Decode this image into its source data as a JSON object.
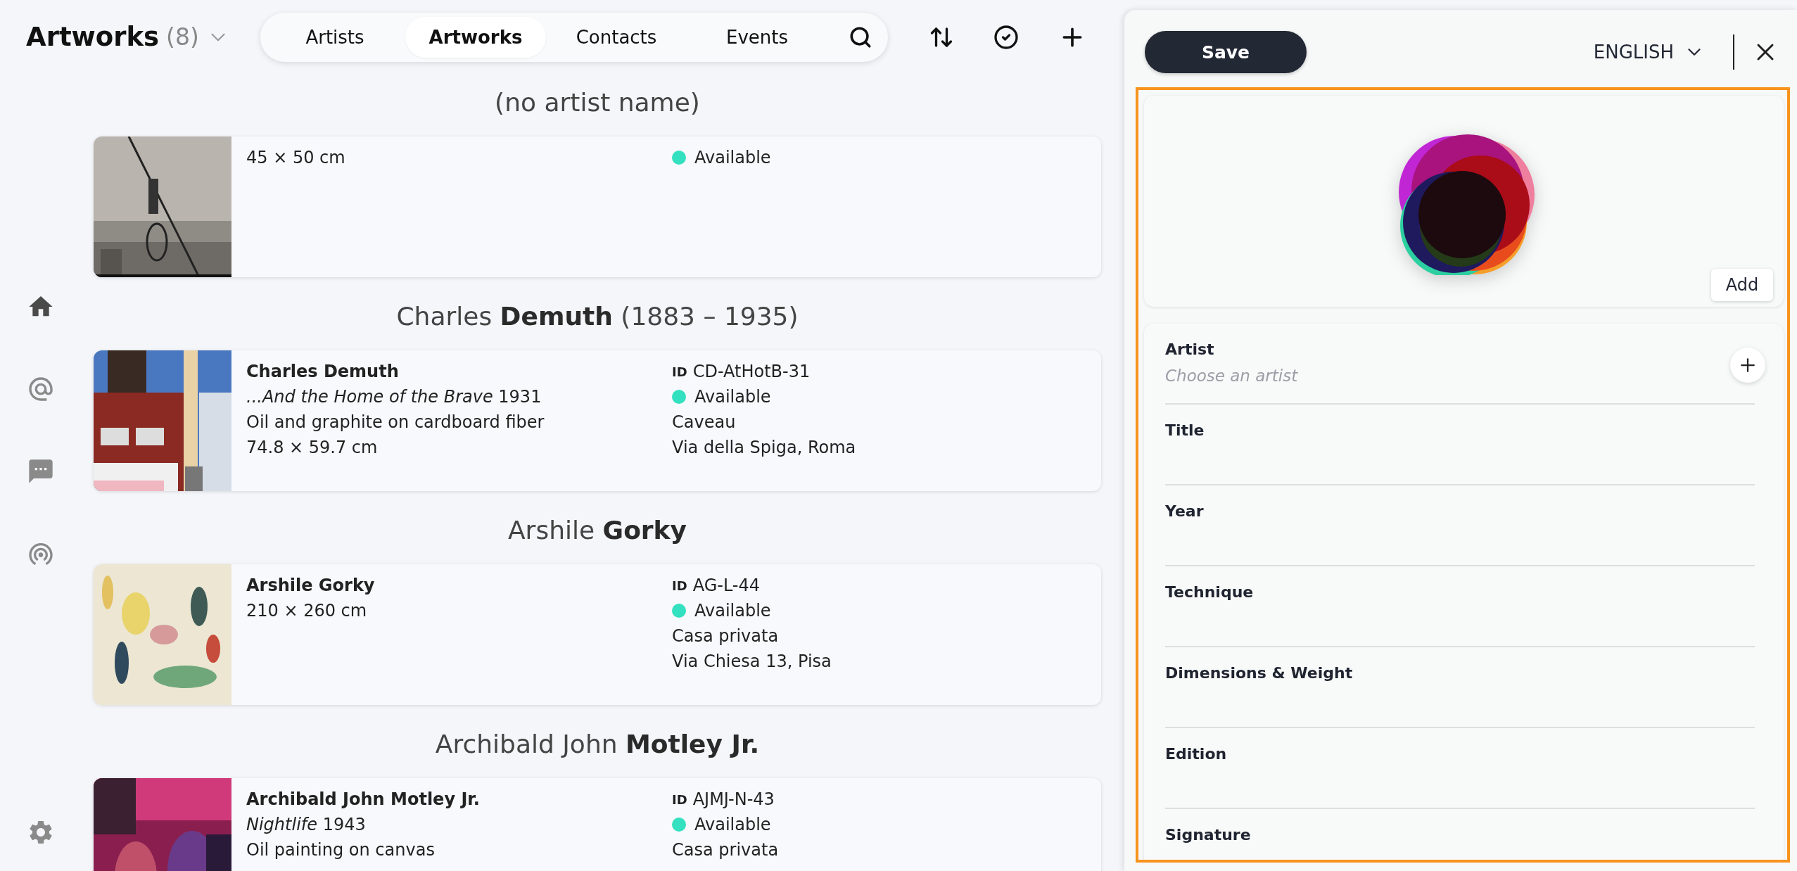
{
  "header": {
    "title": "Artworks",
    "count": "(8)"
  },
  "tabs": [
    {
      "label": "Artists",
      "selected": false
    },
    {
      "label": "Artworks",
      "selected": true
    },
    {
      "label": "Contacts",
      "selected": false
    },
    {
      "label": "Events",
      "selected": false
    }
  ],
  "sidebar": {
    "items": [
      {
        "kind": "home",
        "selected": true
      },
      {
        "kind": "mentions",
        "selected": false
      },
      {
        "kind": "messages",
        "selected": false
      },
      {
        "kind": "broadcast",
        "selected": false
      }
    ],
    "footer": {
      "kind": "settings",
      "selected": false
    }
  },
  "groups": [
    {
      "heading": "(no artist name)",
      "artworks": [
        {
          "details": [
            "45 × 50 cm"
          ],
          "status": "Available"
        }
      ]
    },
    {
      "heading": "Charles **Demuth** (1883 – 1935)",
      "artworks": [
        {
          "artist": "Charles Demuth",
          "details": [
            "*...And the Home of the Brave* 1931",
            "Oil and graphite on cardboard fiber",
            "74.8 × 59.7 cm"
          ],
          "id_label": "ID",
          "id": "CD-AtHotB-31",
          "status": "Available",
          "place": [
            "Caveau",
            "Via della Spiga, Roma"
          ]
        }
      ]
    },
    {
      "heading": "Arshile **Gorky**",
      "artworks": [
        {
          "artist": "Arshile Gorky",
          "details": [
            "210 × 260 cm"
          ],
          "id_label": "ID",
          "id": "AG-L-44",
          "status": "Available",
          "place": [
            "Casa privata",
            "Via Chiesa 13, Pisa"
          ]
        }
      ]
    },
    {
      "heading": "Archibald John **Motley Jr.**",
      "artworks": [
        {
          "artist": "Archibald John Motley Jr.",
          "details": [
            "*Nightlife* 1943",
            "Oil painting on canvas"
          ],
          "id_label": "ID",
          "id": "AJMJ-N-43",
          "status": "Available",
          "place": [
            "Casa privata"
          ]
        }
      ]
    }
  ],
  "editor": {
    "save_button": "Save",
    "language": "ENGLISH",
    "image": {
      "add_button": "Add"
    },
    "fields": [
      {
        "kind": "picker",
        "label": "Artist",
        "placeholder": "Choose an artist"
      },
      {
        "kind": "text",
        "label": "Title"
      },
      {
        "kind": "text",
        "label": "Year"
      },
      {
        "kind": "text",
        "label": "Technique"
      },
      {
        "kind": "text",
        "label": "Dimensions & Weight"
      },
      {
        "kind": "text",
        "label": "Edition"
      },
      {
        "kind": "text",
        "label": "Signature"
      }
    ]
  }
}
